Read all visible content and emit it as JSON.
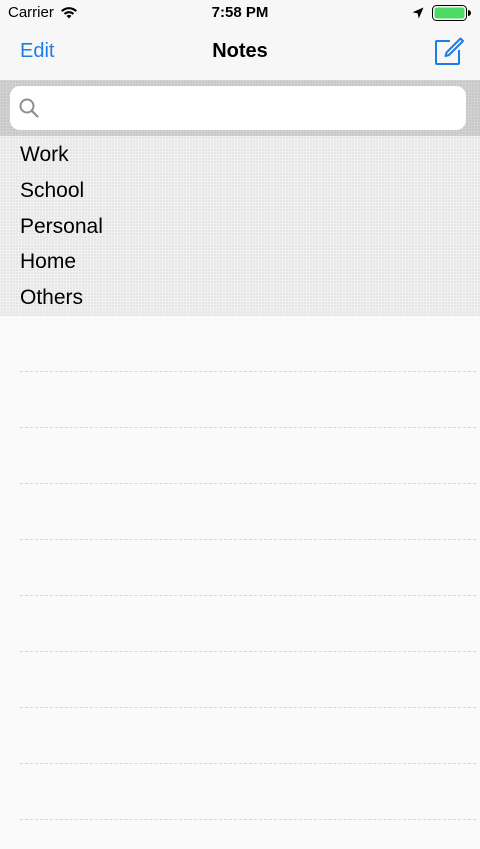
{
  "status_bar": {
    "carrier": "Carrier",
    "time": "7:58 PM",
    "icons": [
      "wifi-icon",
      "location-icon",
      "battery-icon"
    ],
    "battery_color": "#4cd964"
  },
  "nav": {
    "edit_label": "Edit",
    "title": "Notes",
    "compose_icon": "compose-icon",
    "accent_color": "#1a7ee6"
  },
  "search": {
    "placeholder": "",
    "value": ""
  },
  "categories": [
    "Work",
    "School",
    "Personal",
    "Home",
    "Others"
  ]
}
